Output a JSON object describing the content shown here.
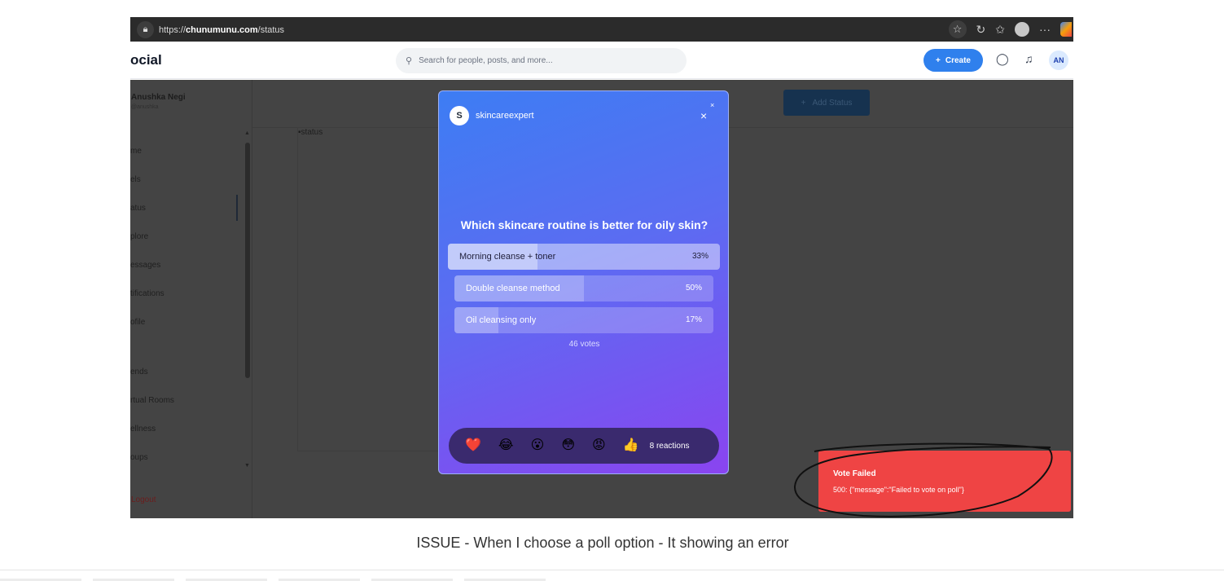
{
  "browser": {
    "url_prefix": "https://",
    "url_domain": "chunumunu.com",
    "url_path": "/status"
  },
  "app": {
    "brand": "ocial",
    "search_placeholder": "Search for people, posts, and more...",
    "create_label": "Create",
    "avatar_initials": "AN"
  },
  "sidebar": {
    "user_name": "Anushka Negi",
    "user_handle": "@anushka",
    "items": [
      "me",
      "els",
      "atus",
      "plore",
      "essages",
      "tifications",
      "ofile",
      "ends",
      "rtual Rooms",
      "ellness",
      "oups"
    ],
    "logout": "Logout"
  },
  "main": {
    "add_status_label": "Add Status",
    "broken_image_alt": "status"
  },
  "modal": {
    "avatar_letter": "S",
    "username": "skincareexpert",
    "close": "×",
    "question": "Which skincare routine is better for oily skin?",
    "options": [
      {
        "label": "Morning cleanse + toner",
        "percent_text": "33%",
        "percent": 33
      },
      {
        "label": "Double cleanse method",
        "percent_text": "50%",
        "percent": 50
      },
      {
        "label": "Oil cleansing only",
        "percent_text": "17%",
        "percent": 17
      }
    ],
    "votes": "46 votes",
    "reactions": [
      "❤️",
      "😂",
      "😮",
      "😳",
      "😡",
      "👍"
    ],
    "reaction_count": "8 reactions"
  },
  "toast": {
    "title": "Vote Failed",
    "message": "500: {\"message\":\"Failed to vote on poll\"}",
    "color": "#ef4444"
  },
  "caption": "ISSUE - When I choose a poll option - It showing an error"
}
